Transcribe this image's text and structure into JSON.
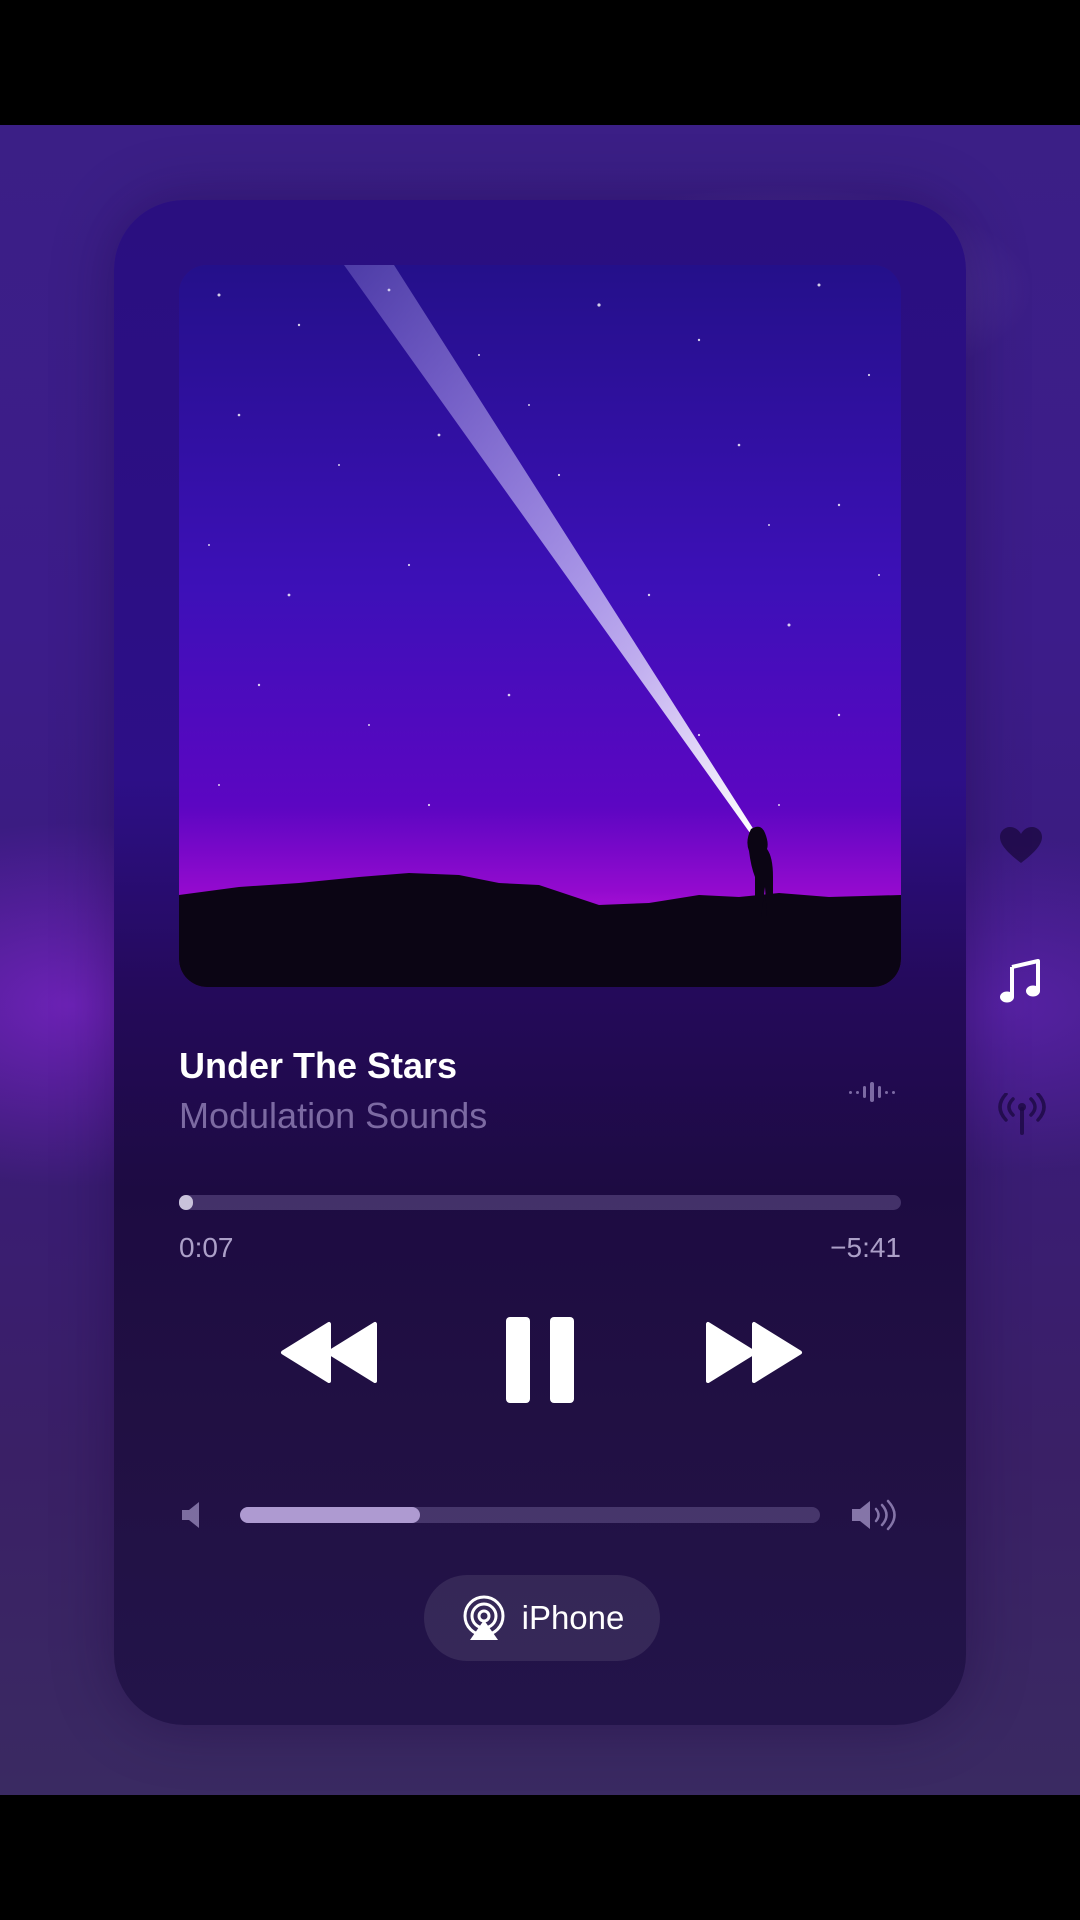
{
  "track": {
    "title": "Under The Stars",
    "artist": "Modulation Sounds"
  },
  "playback": {
    "elapsed": "0:07",
    "remaining": "−5:41",
    "progress_fraction": 0.02,
    "state": "playing"
  },
  "volume": {
    "level_fraction": 0.31
  },
  "output": {
    "device_label": "iPhone"
  },
  "icons": {
    "rewind": "rewind-icon",
    "pause": "pause-icon",
    "forward": "fast-forward-icon",
    "volume_low": "speaker-low-icon",
    "volume_high": "speaker-high-icon",
    "airplay": "airplay-icon",
    "waveform": "waveform-icon",
    "heart": "heart-icon",
    "music": "music-note-icon",
    "broadcast": "broadcast-icon"
  },
  "colors": {
    "background": "#3b1f86",
    "card": "#2a0f80",
    "text_primary": "#ffffff",
    "text_secondary": "#c8b9eb"
  }
}
